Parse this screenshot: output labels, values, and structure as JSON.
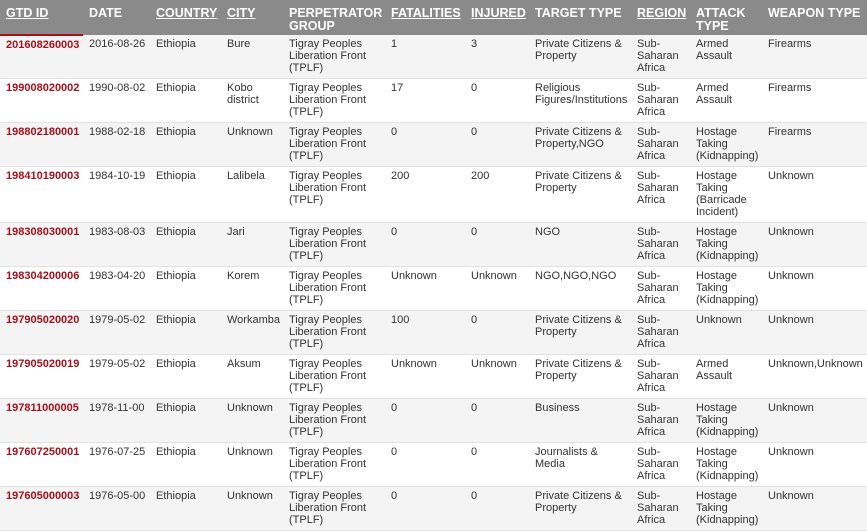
{
  "table": {
    "columns": [
      {
        "key": "gtd_id",
        "label": "GTD ID",
        "sortable": true,
        "active": true
      },
      {
        "key": "date",
        "label": "DATE",
        "sortable": false
      },
      {
        "key": "country",
        "label": "COUNTRY",
        "sortable": true
      },
      {
        "key": "city",
        "label": "CITY",
        "sortable": true
      },
      {
        "key": "perpetrator",
        "label": "PERPETRATOR GROUP",
        "sortable": false
      },
      {
        "key": "fatalities",
        "label": "FATALITIES",
        "sortable": true
      },
      {
        "key": "injured",
        "label": "INJURED",
        "sortable": true
      },
      {
        "key": "target",
        "label": "TARGET TYPE",
        "sortable": false
      },
      {
        "key": "region",
        "label": "REGION",
        "sortable": true
      },
      {
        "key": "attack",
        "label": "ATTACK TYPE",
        "sortable": false
      },
      {
        "key": "weapon",
        "label": "WEAPON TYPE",
        "sortable": false
      }
    ],
    "rows": [
      {
        "gtd_id": "201608260003",
        "date": "2016-08-26",
        "country": "Ethiopia",
        "city": "Bure",
        "perpetrator": "Tigray Peoples Liberation Front (TPLF)",
        "fatalities": "1",
        "injured": "3",
        "target": "Private Citizens & Property",
        "region": "Sub-Saharan Africa",
        "attack": "Armed Assault",
        "weapon": "Firearms"
      },
      {
        "gtd_id": "199008020002",
        "date": "1990-08-02",
        "country": "Ethiopia",
        "city": "Kobo district",
        "perpetrator": "Tigray Peoples Liberation Front (TPLF)",
        "fatalities": "17",
        "injured": "0",
        "target": "Religious Figures/Institutions",
        "region": "Sub-Saharan Africa",
        "attack": "Armed Assault",
        "weapon": "Firearms"
      },
      {
        "gtd_id": "198802180001",
        "date": "1988-02-18",
        "country": "Ethiopia",
        "city": "Unknown",
        "perpetrator": "Tigray Peoples Liberation Front (TPLF)",
        "fatalities": "0",
        "injured": "0",
        "target": "Private Citizens & Property,NGO",
        "region": "Sub-Saharan Africa",
        "attack": "Hostage Taking (Kidnapping)",
        "weapon": "Firearms"
      },
      {
        "gtd_id": "198410190003",
        "date": "1984-10-19",
        "country": "Ethiopia",
        "city": "Lalibela",
        "perpetrator": "Tigray Peoples Liberation Front (TPLF)",
        "fatalities": "200",
        "injured": "200",
        "target": "Private Citizens & Property",
        "region": "Sub-Saharan Africa",
        "attack": "Hostage Taking (Barricade Incident)",
        "weapon": "Unknown"
      },
      {
        "gtd_id": "198308030001",
        "date": "1983-08-03",
        "country": "Ethiopia",
        "city": "Jari",
        "perpetrator": "Tigray Peoples Liberation Front (TPLF)",
        "fatalities": "0",
        "injured": "0",
        "target": "NGO",
        "region": "Sub-Saharan Africa",
        "attack": "Hostage Taking (Kidnapping)",
        "weapon": "Unknown"
      },
      {
        "gtd_id": "198304200006",
        "date": "1983-04-20",
        "country": "Ethiopia",
        "city": "Korem",
        "perpetrator": "Tigray Peoples Liberation Front (TPLF)",
        "fatalities": "Unknown",
        "injured": "Unknown",
        "target": "NGO,NGO,NGO",
        "region": "Sub-Saharan Africa",
        "attack": "Hostage Taking (Kidnapping)",
        "weapon": "Unknown"
      },
      {
        "gtd_id": "197905020020",
        "date": "1979-05-02",
        "country": "Ethiopia",
        "city": "Workamba",
        "perpetrator": "Tigray Peoples Liberation Front (TPLF)",
        "fatalities": "100",
        "injured": "0",
        "target": "Private Citizens & Property",
        "region": "Sub-Saharan Africa",
        "attack": "Unknown",
        "weapon": "Unknown"
      },
      {
        "gtd_id": "197905020019",
        "date": "1979-05-02",
        "country": "Ethiopia",
        "city": "Aksum",
        "perpetrator": "Tigray Peoples Liberation Front (TPLF)",
        "fatalities": "Unknown",
        "injured": "Unknown",
        "target": "Private Citizens & Property",
        "region": "Sub-Saharan Africa",
        "attack": "Armed Assault",
        "weapon": "Unknown,Unknown"
      },
      {
        "gtd_id": "197811000005",
        "date": "1978-11-00",
        "country": "Ethiopia",
        "city": "Unknown",
        "perpetrator": "Tigray Peoples Liberation Front (TPLF)",
        "fatalities": "0",
        "injured": "0",
        "target": "Business",
        "region": "Sub-Saharan Africa",
        "attack": "Hostage Taking (Kidnapping)",
        "weapon": "Unknown"
      },
      {
        "gtd_id": "197607250001",
        "date": "1976-07-25",
        "country": "Ethiopia",
        "city": "Unknown",
        "perpetrator": "Tigray Peoples Liberation Front (TPLF)",
        "fatalities": "0",
        "injured": "0",
        "target": "Journalists & Media",
        "region": "Sub-Saharan Africa",
        "attack": "Hostage Taking (Kidnapping)",
        "weapon": "Unknown"
      },
      {
        "gtd_id": "197605000003",
        "date": "1976-05-00",
        "country": "Ethiopia",
        "city": "Unknown",
        "perpetrator": "Tigray Peoples Liberation Front (TPLF)",
        "fatalities": "0",
        "injured": "0",
        "target": "Private Citizens & Property",
        "region": "Sub-Saharan Africa",
        "attack": "Hostage Taking (Kidnapping)",
        "weapon": "Unknown"
      }
    ]
  },
  "colors": {
    "header_bg": "#8a8a8a",
    "header_text": "#ffffff",
    "id_link": "#a8111a",
    "row_stripe": "#f4f4f4",
    "body_text": "#333333"
  }
}
